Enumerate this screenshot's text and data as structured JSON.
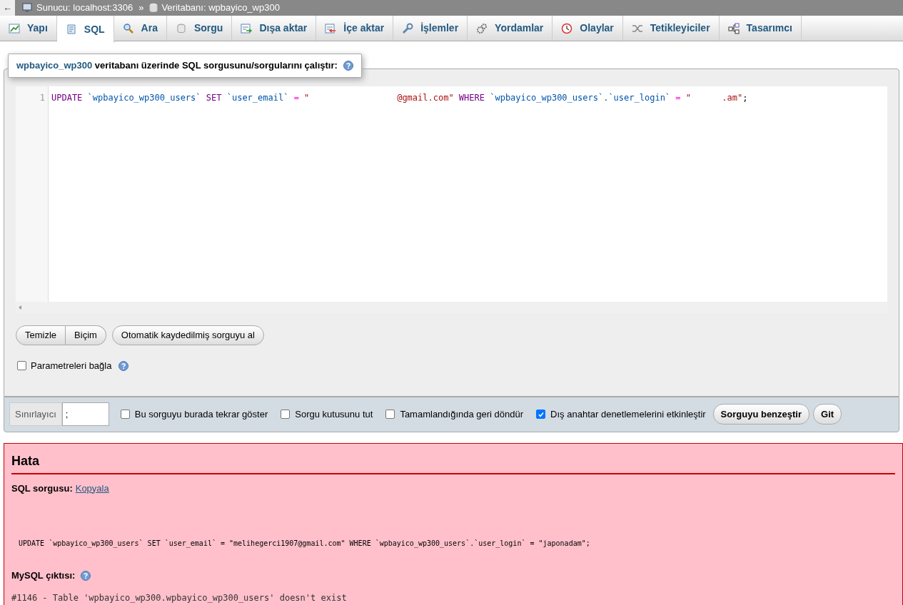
{
  "breadcrumb": {
    "back": "←",
    "items": [
      {
        "kind": "server",
        "label": "Sunucu: localhost:3306"
      },
      {
        "kind": "database",
        "label": "Veritabanı: wpbayico_wp300"
      }
    ],
    "separator": "»"
  },
  "tabs": [
    {
      "label": "Yapı",
      "selected": false
    },
    {
      "label": "SQL",
      "selected": true
    },
    {
      "label": "Ara",
      "selected": false
    },
    {
      "label": "Sorgu",
      "selected": false
    },
    {
      "label": "Dışa aktar",
      "selected": false
    },
    {
      "label": "İçe aktar",
      "selected": false
    },
    {
      "label": "İşlemler",
      "selected": false
    },
    {
      "label": "Yordamlar",
      "selected": false
    },
    {
      "label": "Olaylar",
      "selected": false
    },
    {
      "label": "Tetikleyiciler",
      "selected": false
    },
    {
      "label": "Tasarımcı",
      "selected": false
    }
  ],
  "legend": {
    "database": "wpbayico_wp300",
    "text": "veritabanı üzerinde SQL sorgusunu/sorgularını çalıştır:"
  },
  "editor": {
    "line_number": "1",
    "tokens": [
      {
        "kind": "keyword",
        "text": "UPDATE"
      },
      {
        "kind": "ident",
        "text": "`wpbayico_wp300_users`"
      },
      {
        "kind": "keyword",
        "text": "SET"
      },
      {
        "kind": "ident",
        "text": "`user_email`"
      },
      {
        "kind": "operator",
        "text": "="
      },
      {
        "kind": "string",
        "text": "\"                 @gmail.com\""
      },
      {
        "kind": "keyword",
        "text": "WHERE"
      },
      {
        "kind": "ident",
        "text": "`wpbayico_wp300_users`.`user_login`"
      },
      {
        "kind": "operator",
        "text": "="
      },
      {
        "kind": "string",
        "text": "\"      .am\""
      },
      {
        "kind": "punct",
        "text": ";"
      }
    ]
  },
  "editor_buttons": {
    "group": [
      "Temizle",
      "Biçim"
    ],
    "autosave": "Otomatik kaydedilmiş sorguyu al"
  },
  "bind_parameters": {
    "label": "Parametreleri bağla",
    "checked": false
  },
  "options": {
    "delimiter_label": "Sınırlayıcı",
    "delimiter_value": ";",
    "checkboxes": [
      {
        "label": "Bu sorguyu burada tekrar göster",
        "checked": false
      },
      {
        "label": "Sorgu kutusunu tut",
        "checked": false
      },
      {
        "label": "Tamamlandığında geri döndür",
        "checked": false
      },
      {
        "label": "Dış anahtar denetlemelerini etkinleştir",
        "checked": true
      }
    ],
    "buttons": [
      "Sorguyu benzeştir",
      "Git"
    ]
  },
  "error": {
    "title": "Hata",
    "sql_label": "SQL sorgusu:",
    "copy_link": "Kopyala",
    "query": "UPDATE `wpbayico_wp300_users` SET `user_email` = \"melihegerci1907@gmail.com\" WHERE `wpbayico_wp300_users`.`user_login` = \"japonadam\";",
    "output_label": "MySQL çıktısı:",
    "message": "#1146 - Table 'wpbayico_wp300.wpbayico_wp300_users' doesn't exist"
  }
}
